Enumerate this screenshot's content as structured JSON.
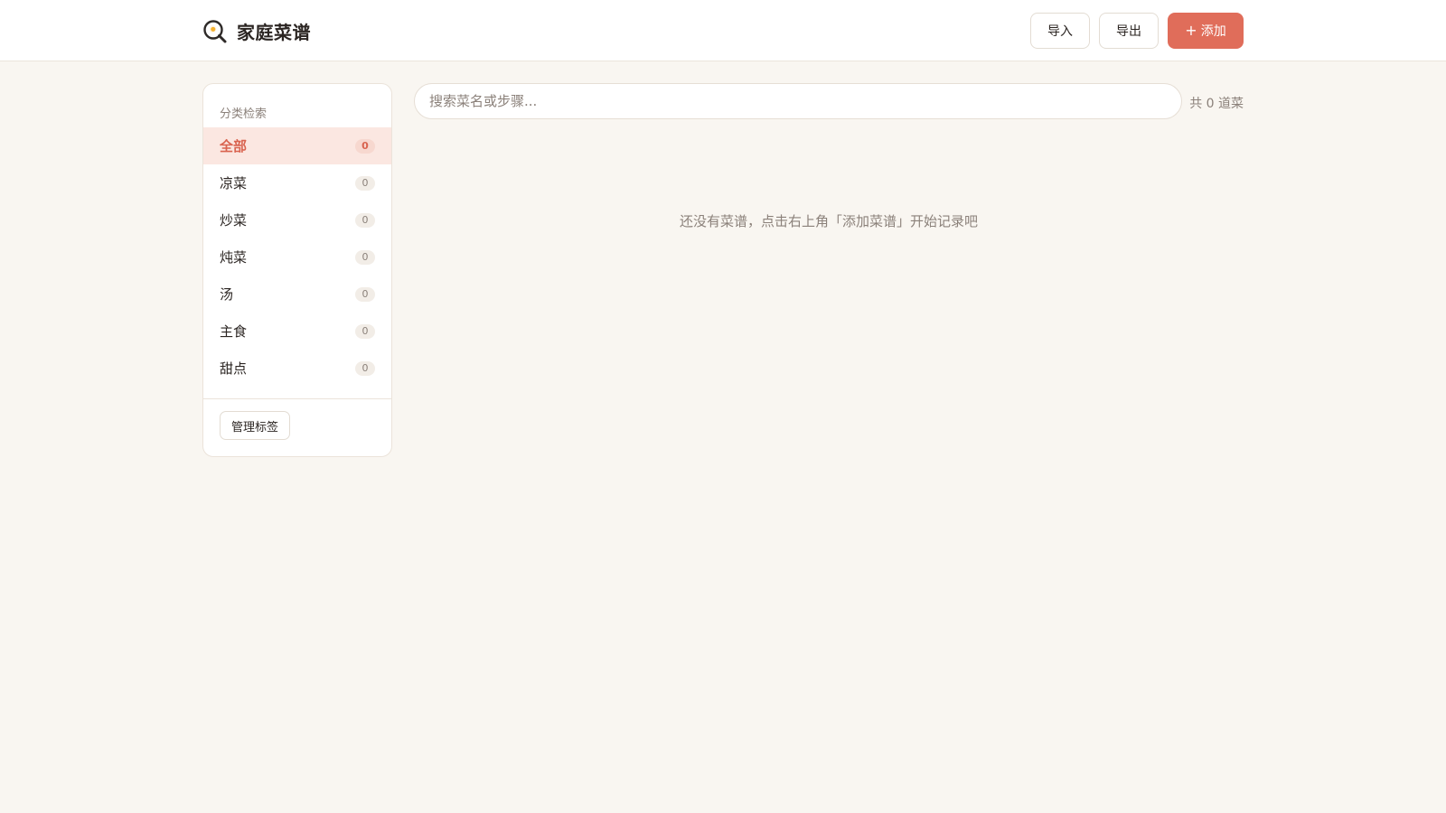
{
  "header": {
    "title": "家庭菜谱",
    "logo_icon": "frying-pan-egg-icon"
  },
  "actions": {
    "import_label": "导入",
    "export_label": "导出",
    "add_icon": "+",
    "add_label": "添加"
  },
  "sidebar": {
    "heading": "分类检索",
    "items": [
      {
        "label": "全部",
        "count": "0",
        "active": true
      },
      {
        "label": "凉菜",
        "count": "0"
      },
      {
        "label": "炒菜",
        "count": "0"
      },
      {
        "label": "炖菜",
        "count": "0"
      },
      {
        "label": "汤",
        "count": "0"
      },
      {
        "label": "主食",
        "count": "0"
      },
      {
        "label": "甜点",
        "count": "0"
      }
    ],
    "manage_tags_label": "管理标签"
  },
  "search": {
    "placeholder": "搜索菜名或步骤...",
    "value": ""
  },
  "summary": {
    "total_text": "共 0 道菜"
  },
  "empty_state": {
    "message": "还没有菜谱，点击右上角「添加菜谱」开始记录吧"
  },
  "colors": {
    "accent": "#e06d5a",
    "background": "#f9f6f1",
    "active_item_bg": "#fbe7e1",
    "muted_text": "#8b817a"
  }
}
